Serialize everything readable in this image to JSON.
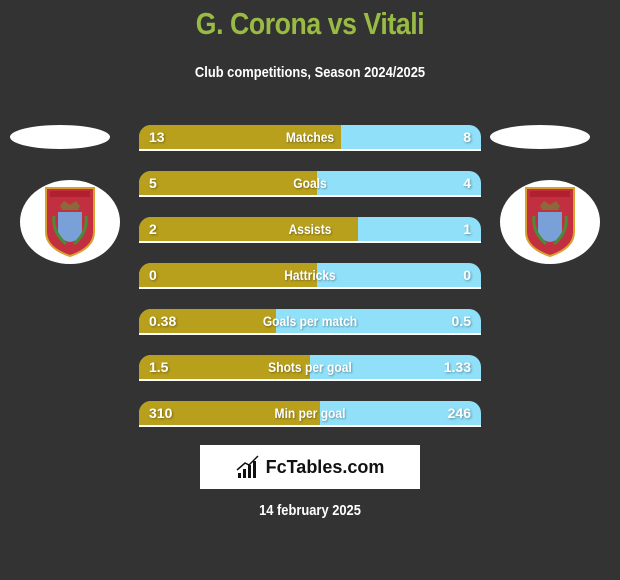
{
  "header": {
    "title": "G. Corona vs Vitali",
    "subtitle": "Club competitions, Season 2024/2025"
  },
  "teams": {
    "left": {
      "name": "G. Corona",
      "logo_icon": "club-crest-icon"
    },
    "right": {
      "name": "Vitali",
      "logo_icon": "club-crest-icon"
    }
  },
  "colors": {
    "left": "#b8a01c",
    "right": "#8fe0f8",
    "title": "#99bb44",
    "background": "#333333"
  },
  "stats": [
    {
      "label": "Matches",
      "left": "13",
      "right": "8",
      "left_share": 0.59
    },
    {
      "label": "Goals",
      "left": "5",
      "right": "4",
      "left_share": 0.52
    },
    {
      "label": "Assists",
      "left": "2",
      "right": "1",
      "left_share": 0.64
    },
    {
      "label": "Hattricks",
      "left": "0",
      "right": "0",
      "left_share": 0.52
    },
    {
      "label": "Goals per match",
      "left": "0.38",
      "right": "0.5",
      "left_share": 0.4
    },
    {
      "label": "Shots per goal",
      "left": "1.5",
      "right": "1.33",
      "left_share": 0.5
    },
    {
      "label": "Min per goal",
      "left": "310",
      "right": "246",
      "left_share": 0.53
    }
  ],
  "brand": {
    "text": "FcTables.com",
    "icon": "bar-chart-icon"
  },
  "footer": {
    "date": "14 february 2025"
  }
}
